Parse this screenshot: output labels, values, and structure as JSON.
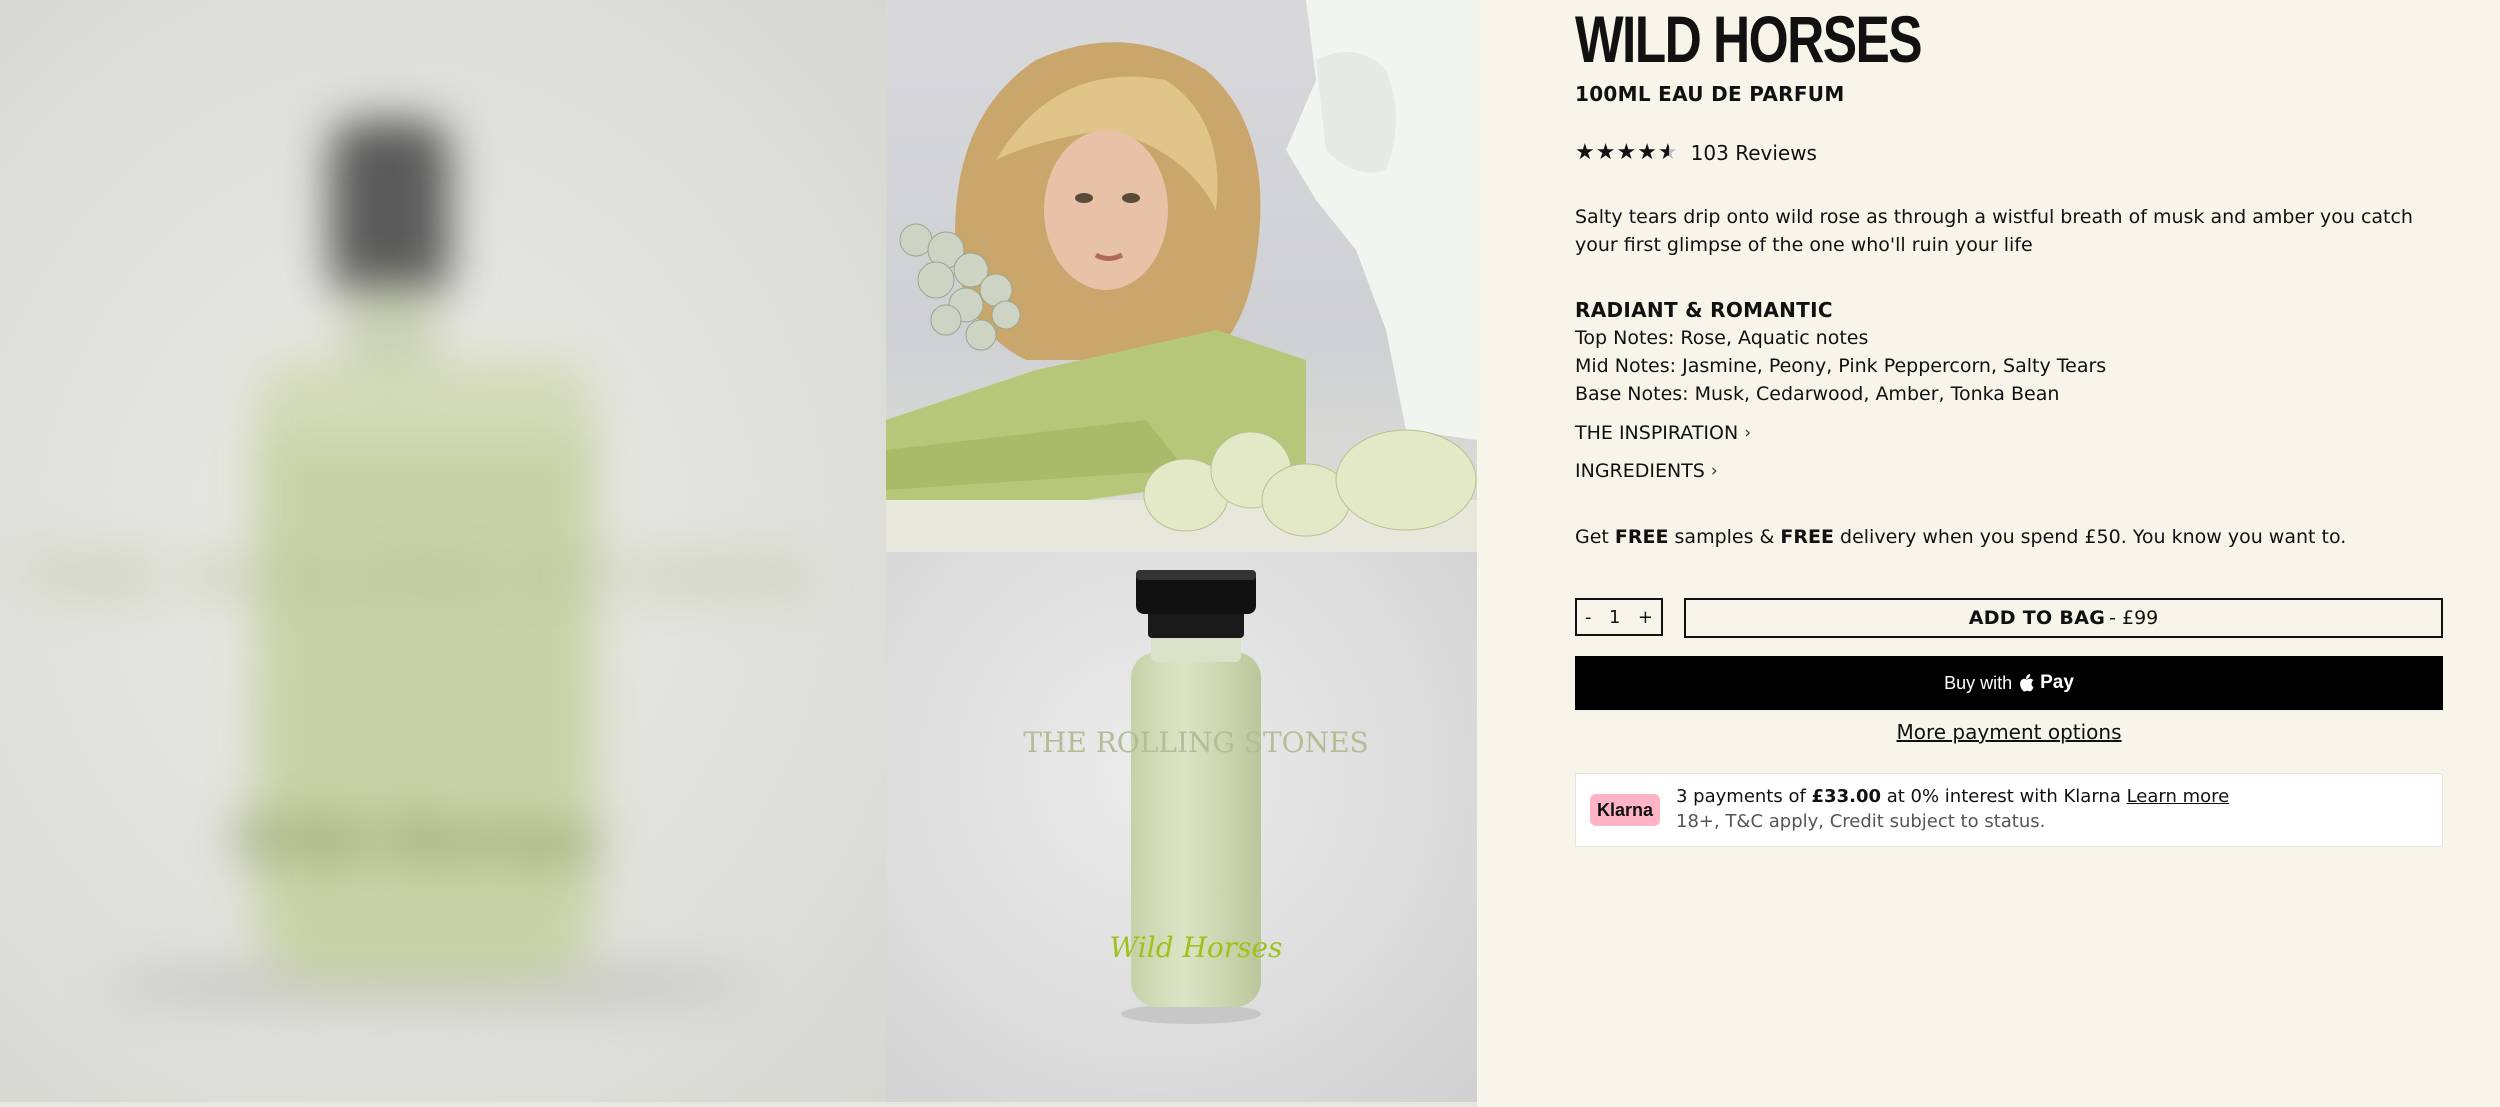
{
  "product": {
    "title": "WILD HORSES",
    "subtitle": "100ML EAU DE PARFUM",
    "rating_value": 4.5,
    "reviews_label": "103 Reviews",
    "description": "Salty tears drip onto wild rose as through a wistful breath of musk and amber you catch your first glimpse of the one who'll ruin your life"
  },
  "notes": {
    "heading": "RADIANT & ROMANTIC",
    "top": "Top Notes: Rose, Aquatic notes",
    "mid": "Mid Notes: Jasmine, Peony, Pink Peppercorn, Salty Tears",
    "base": "Base Notes: Musk, Cedarwood, Amber, Tonka Bean"
  },
  "accordions": {
    "inspiration": "THE INSPIRATION",
    "ingredients": "INGREDIENTS"
  },
  "promo": {
    "get": "Get ",
    "free1": "FREE",
    "samples": " samples & ",
    "free2": "FREE",
    "rest": " delivery when you spend £50. You know you want to."
  },
  "purchase": {
    "minus": "-",
    "quantity": "1",
    "plus": "+",
    "add_label": "ADD TO BAG",
    "price": "- £99",
    "buy_with": "Buy with",
    "pay_brand": "Pay",
    "more_options": "More payment options"
  },
  "klarna": {
    "badge": "Klarna",
    "prefix": "3 payments of ",
    "amount": "£33.00",
    "mid": " at 0% interest with Klarna ",
    "learn_more": "Learn more",
    "disclaimer": "18+, T&C apply, Credit subject to status."
  },
  "artwork": {
    "bottle_text_1": "THE ROLLING STONES",
    "bottle_text_2": "Wild Horses"
  },
  "colors": {
    "page_bg": "#f7f4e9",
    "bottle_green": "#d3dcb6",
    "cap_black": "#111111",
    "klarna_pink": "#ffb3c7"
  }
}
